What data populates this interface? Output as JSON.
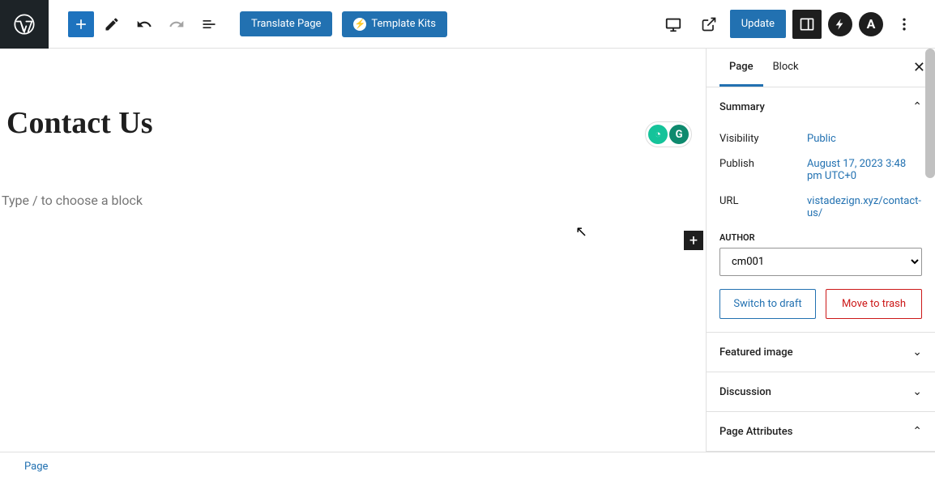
{
  "topbar": {
    "translate": "Translate Page",
    "templateKits": "Template Kits",
    "update": "Update"
  },
  "page": {
    "title": "Contact Us",
    "placeholder": "Type / to choose a block"
  },
  "sidebar": {
    "tabs": {
      "page": "Page",
      "block": "Block"
    },
    "summary": {
      "title": "Summary",
      "visibility": {
        "label": "Visibility",
        "value": "Public"
      },
      "publish": {
        "label": "Publish",
        "value": "August 17, 2023 3:48 pm UTC+0"
      },
      "url": {
        "label": "URL",
        "value": "vistadezign.xyz/contact-us/"
      },
      "author": {
        "label": "AUTHOR",
        "value": "cm001"
      },
      "switchDraft": "Switch to draft",
      "moveTrash": "Move to trash"
    },
    "panels": {
      "featuredImage": "Featured image",
      "discussion": "Discussion",
      "pageAttributes": "Page Attributes"
    }
  },
  "footer": {
    "breadcrumb": "Page"
  }
}
